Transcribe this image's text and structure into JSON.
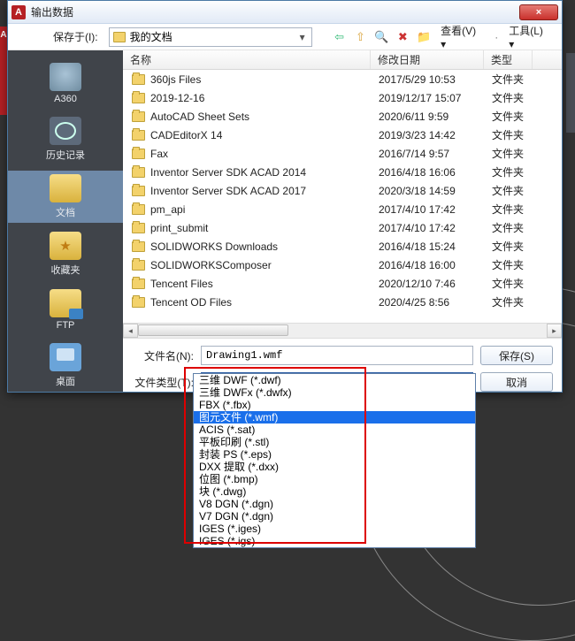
{
  "titlebar": {
    "title": "输出数据",
    "app_letter": "A",
    "close": "×"
  },
  "toprow": {
    "save_in_label": "保存于(I):",
    "location": "我的文档",
    "view_menu": "查看(V)",
    "tools_menu": "工具(L)"
  },
  "sidebar": [
    {
      "id": "a360",
      "label": "A360"
    },
    {
      "id": "history",
      "label": "历史记录"
    },
    {
      "id": "docs",
      "label": "文档",
      "selected": true
    },
    {
      "id": "fav",
      "label": "收藏夹"
    },
    {
      "id": "ftp",
      "label": "FTP"
    },
    {
      "id": "desktop",
      "label": "桌面"
    }
  ],
  "columns": {
    "name": "名称",
    "date": "修改日期",
    "type": "类型"
  },
  "rows": [
    {
      "name": "360js Files",
      "date": "2017/5/29 10:53",
      "type": "文件夹"
    },
    {
      "name": "2019-12-16",
      "date": "2019/12/17 15:07",
      "type": "文件夹"
    },
    {
      "name": "AutoCAD Sheet Sets",
      "date": "2020/6/11 9:59",
      "type": "文件夹"
    },
    {
      "name": "CADEditorX 14",
      "date": "2019/3/23 14:42",
      "type": "文件夹"
    },
    {
      "name": "Fax",
      "date": "2016/7/14 9:57",
      "type": "文件夹"
    },
    {
      "name": "Inventor Server SDK ACAD 2014",
      "date": "2016/4/18 16:06",
      "type": "文件夹"
    },
    {
      "name": "Inventor Server SDK ACAD 2017",
      "date": "2020/3/18 14:59",
      "type": "文件夹"
    },
    {
      "name": "pm_api",
      "date": "2017/4/10 17:42",
      "type": "文件夹"
    },
    {
      "name": "print_submit",
      "date": "2017/4/10 17:42",
      "type": "文件夹"
    },
    {
      "name": "SOLIDWORKS Downloads",
      "date": "2016/4/18 15:24",
      "type": "文件夹"
    },
    {
      "name": "SOLIDWORKSComposer",
      "date": "2016/4/18 16:00",
      "type": "文件夹"
    },
    {
      "name": "Tencent Files",
      "date": "2020/12/10 7:46",
      "type": "文件夹"
    },
    {
      "name": "Tencent OD Files",
      "date": "2020/4/25 8:56",
      "type": "文件夹"
    }
  ],
  "form": {
    "filename_label": "文件名(N):",
    "filename_value": "Drawing1.wmf",
    "filetype_label": "文件类型(T):",
    "filetype_value": "图元文件 (*.wmf)",
    "save_btn": "保存(S)",
    "cancel_btn": "取消"
  },
  "filetype_options": [
    "三维 DWF (*.dwf)",
    "三维 DWFx (*.dwfx)",
    "FBX (*.fbx)",
    "图元文件 (*.wmf)",
    "ACIS (*.sat)",
    "平板印刷 (*.stl)",
    "封装 PS (*.eps)",
    "DXX 提取 (*.dxx)",
    "位图 (*.bmp)",
    "块 (*.dwg)",
    "V8 DGN (*.dgn)",
    "V7 DGN (*.dgn)",
    "IGES (*.iges)",
    "IGES (*.igs)"
  ],
  "filetype_selected_index": 3
}
